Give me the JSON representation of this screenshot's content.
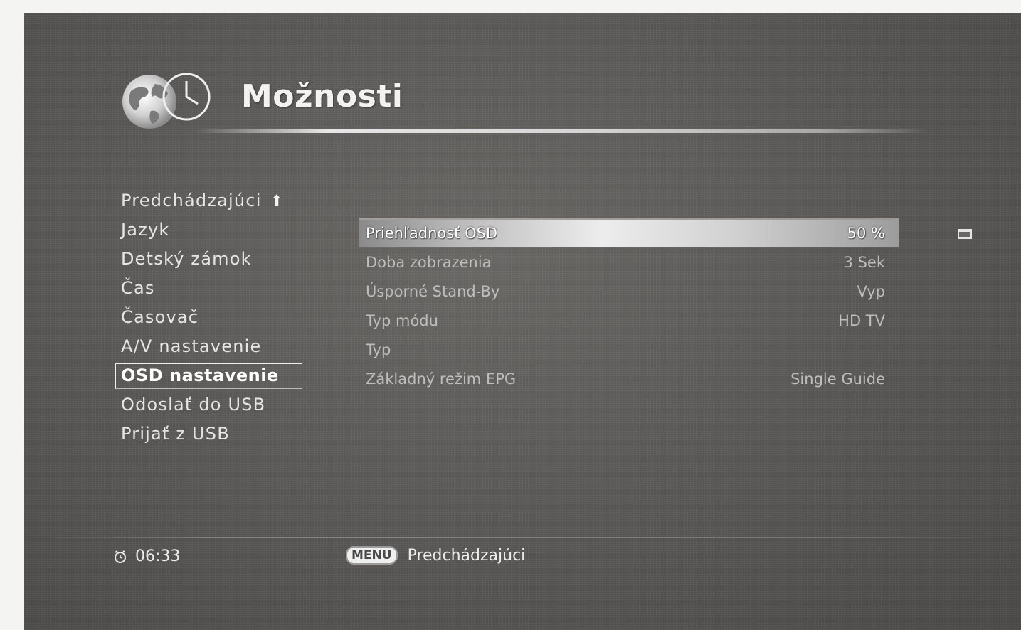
{
  "header": {
    "title": "Možnosti",
    "logo_icon": "globe-clock-icon"
  },
  "menu": {
    "items": [
      {
        "label": "Predchádzajúci",
        "icon": "up-arrow-icon"
      },
      {
        "label": "Jazyk"
      },
      {
        "label": "Detský zámok"
      },
      {
        "label": "Čas"
      },
      {
        "label": "Časovač"
      },
      {
        "label": "A/V nastavenie"
      },
      {
        "label": "OSD nastavenie",
        "selected": true
      },
      {
        "label": "Odoslať do USB"
      },
      {
        "label": "Prijať z USB"
      }
    ]
  },
  "settings": {
    "rows": [
      {
        "label": "Priehľadnosť OSD",
        "value": "50 %",
        "highlighted": true
      },
      {
        "label": "Doba zobrazenia",
        "value": "3 Sek"
      },
      {
        "label": "Úsporné Stand-By",
        "value": "Vyp"
      },
      {
        "label": "Typ módu",
        "value": "HD TV"
      },
      {
        "label": "Typ",
        "value": ""
      },
      {
        "label": "Základný režim EPG",
        "value": "Single Guide"
      }
    ],
    "scroll_icon": "scroll-indicator-icon"
  },
  "footer": {
    "clock_icon": "alarm-clock-icon",
    "time": "06:33",
    "menu_key": "MENU",
    "menu_key_action": "Predchádzajúci"
  },
  "colors": {
    "background": "#5e5c5a",
    "text": "#e6e6e6",
    "dim_text": "#bdbdbd"
  }
}
